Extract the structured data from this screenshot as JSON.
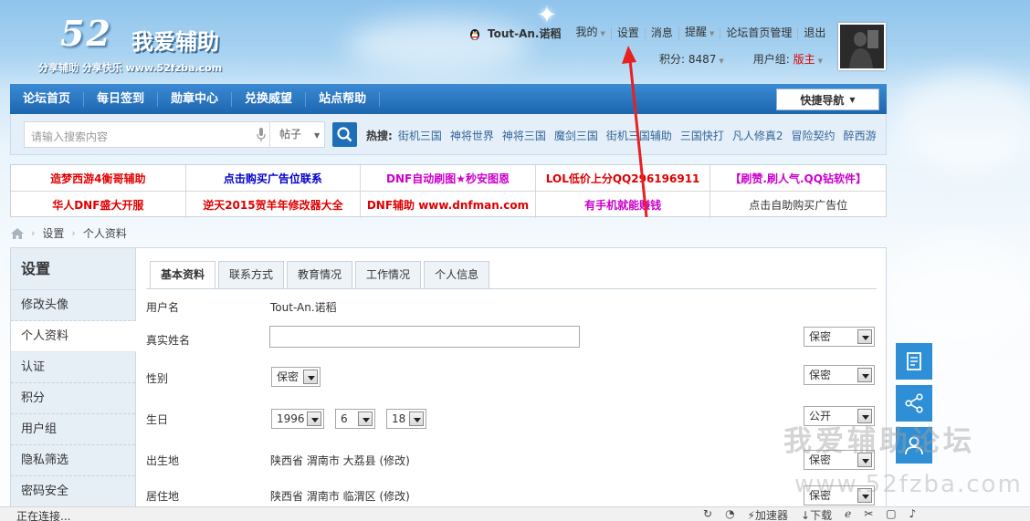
{
  "logo": {
    "number": "52",
    "name": "我爱辅助",
    "tagline": "分享辅助  分享快乐  www.52fzba.com"
  },
  "user": {
    "name": "Tout-An.诺稻",
    "menu": [
      "我的",
      "设置",
      "消息",
      "提醒",
      "论坛首页管理",
      "退出"
    ],
    "points_label": "积分: 8487",
    "group_label": "用户组: ",
    "group_value": "版主"
  },
  "nav": {
    "items": [
      "论坛首页",
      "每日签到",
      "勋章中心",
      "兑换威望",
      "站点帮助"
    ],
    "quick": "快捷导航"
  },
  "search": {
    "placeholder": "请输入搜索内容",
    "scope": "帖子",
    "hot_label": "热搜:",
    "hot": [
      "街机三国",
      "神将世界",
      "神将三国",
      "魔剑三国",
      "街机三国辅助",
      "三国快打",
      "凡人修真2",
      "冒险契约",
      "醉西游"
    ]
  },
  "ads": [
    {
      "text": "造梦西游4衡哥辅助",
      "color": "#e00000"
    },
    {
      "text": "点击购买广告位联系",
      "color": "#0000cc"
    },
    {
      "text": "DNF自动刷图★秒安图恩",
      "color": "#cc00cc"
    },
    {
      "text": "LOL低价上分QQ296196911",
      "color": "#e00000"
    },
    {
      "text": "【刷赞.刷人气.QQ钻软件】",
      "color": "#cc00cc"
    },
    {
      "text": "华人DNF盛大开服",
      "color": "#e00000"
    },
    {
      "text": "逆天2015贺羊年修改器大全",
      "color": "#e00000"
    },
    {
      "text": "DNF辅助 www.dnfman.com",
      "color": "#e00000"
    },
    {
      "text": "有手机就能赚钱",
      "color": "#cc00cc"
    },
    {
      "text": "点击自助购买广告位",
      "color": "#333333"
    }
  ],
  "breadcrumb": [
    "设置",
    "个人资料"
  ],
  "sidebar": {
    "title": "设置",
    "items": [
      "修改头像",
      "个人资料",
      "认证",
      "积分",
      "用户组",
      "隐私筛选",
      "密码安全"
    ]
  },
  "tabs": [
    "基本资料",
    "联系方式",
    "教育情况",
    "工作情况",
    "个人信息"
  ],
  "form": {
    "username_label": "用户名",
    "username_value": "Tout-An.诺稻",
    "realname_label": "真实姓名",
    "gender_label": "性别",
    "gender_value": "保密",
    "birthday_label": "生日",
    "birth_year": "1996",
    "birth_month": "6",
    "birth_day": "18",
    "birthplace_label": "出生地",
    "birthplace_value": "陕西省 渭南市 大荔县 (修改)",
    "residence_label": "居住地",
    "residence_value": "陕西省 渭南市 临渭区 (修改)",
    "privacy": [
      "保密",
      "保密",
      "公开",
      "保密",
      "保密"
    ]
  },
  "watermark": {
    "line1": "我爱辅助论坛",
    "line2": "www.52fzba.com"
  },
  "status": {
    "left": "正在连接...",
    "right": [
      "加速器",
      "下载"
    ]
  },
  "colors": {
    "nav": "#2b78c2",
    "accent_red": "#dd0000",
    "fab": "#2e8ed6"
  }
}
